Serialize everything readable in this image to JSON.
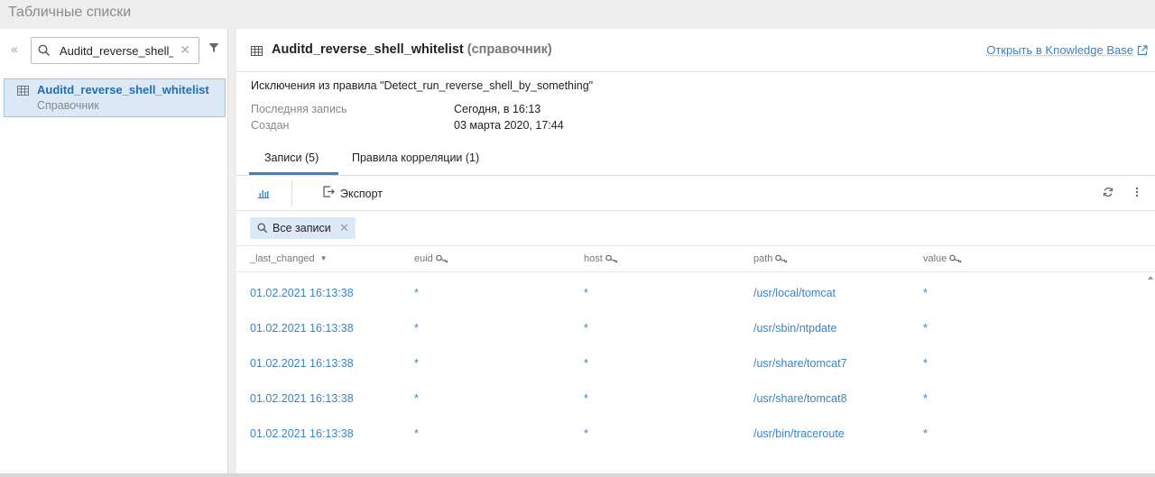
{
  "app": {
    "title": "Табличные списки"
  },
  "sidebar": {
    "collapse_label": "«",
    "search": {
      "value": "Auditd_reverse_shell_whitelist",
      "placeholder": ""
    },
    "items": [
      {
        "name": "Auditd_reverse_shell_whitelist",
        "type": "Справочник"
      }
    ]
  },
  "detail": {
    "title": "Auditd_reverse_shell_whitelist",
    "kind": "(справочник)",
    "kb_link": "Открыть в Knowledge Base",
    "description": "Исключения из правила \"Detect_run_reverse_shell_by_something\"",
    "last_record_label": "Последняя запись",
    "last_record_value": "Сегодня, в 16:13",
    "created_label": "Создан",
    "created_value": "03 марта 2020, 17:44"
  },
  "tabs": [
    {
      "label": "Записи (5)",
      "active": true
    },
    {
      "label": "Правила корреляции (1)",
      "active": false
    }
  ],
  "toolbar": {
    "export_label": "Экспорт"
  },
  "filter_chip": {
    "label": "Все записи"
  },
  "table": {
    "columns": [
      "_last_changed",
      "euid",
      "host",
      "path",
      "value"
    ],
    "rows": [
      {
        "last_changed": "01.02.2021 16:13:38",
        "euid": "*",
        "host": "*",
        "path": "/usr/local/tomcat",
        "value": "*"
      },
      {
        "last_changed": "01.02.2021 16:13:38",
        "euid": "*",
        "host": "*",
        "path": "/usr/sbin/ntpdate",
        "value": "*"
      },
      {
        "last_changed": "01.02.2021 16:13:38",
        "euid": "*",
        "host": "*",
        "path": "/usr/share/tomcat7",
        "value": "*"
      },
      {
        "last_changed": "01.02.2021 16:13:38",
        "euid": "*",
        "host": "*",
        "path": "/usr/share/tomcat8",
        "value": "*"
      },
      {
        "last_changed": "01.02.2021 16:13:38",
        "euid": "*",
        "host": "*",
        "path": "/usr/bin/traceroute",
        "value": "*"
      }
    ]
  },
  "colors": {
    "accent": "#3a83c4",
    "selected_bg": "#dbe9f6",
    "muted": "#888888"
  },
  "icons": [
    "search-icon",
    "clear-icon",
    "filter-icon",
    "table-icon",
    "external-link-icon",
    "chart-icon",
    "export-icon",
    "refresh-icon",
    "more-icon",
    "key-icon",
    "sort-desc-icon"
  ]
}
